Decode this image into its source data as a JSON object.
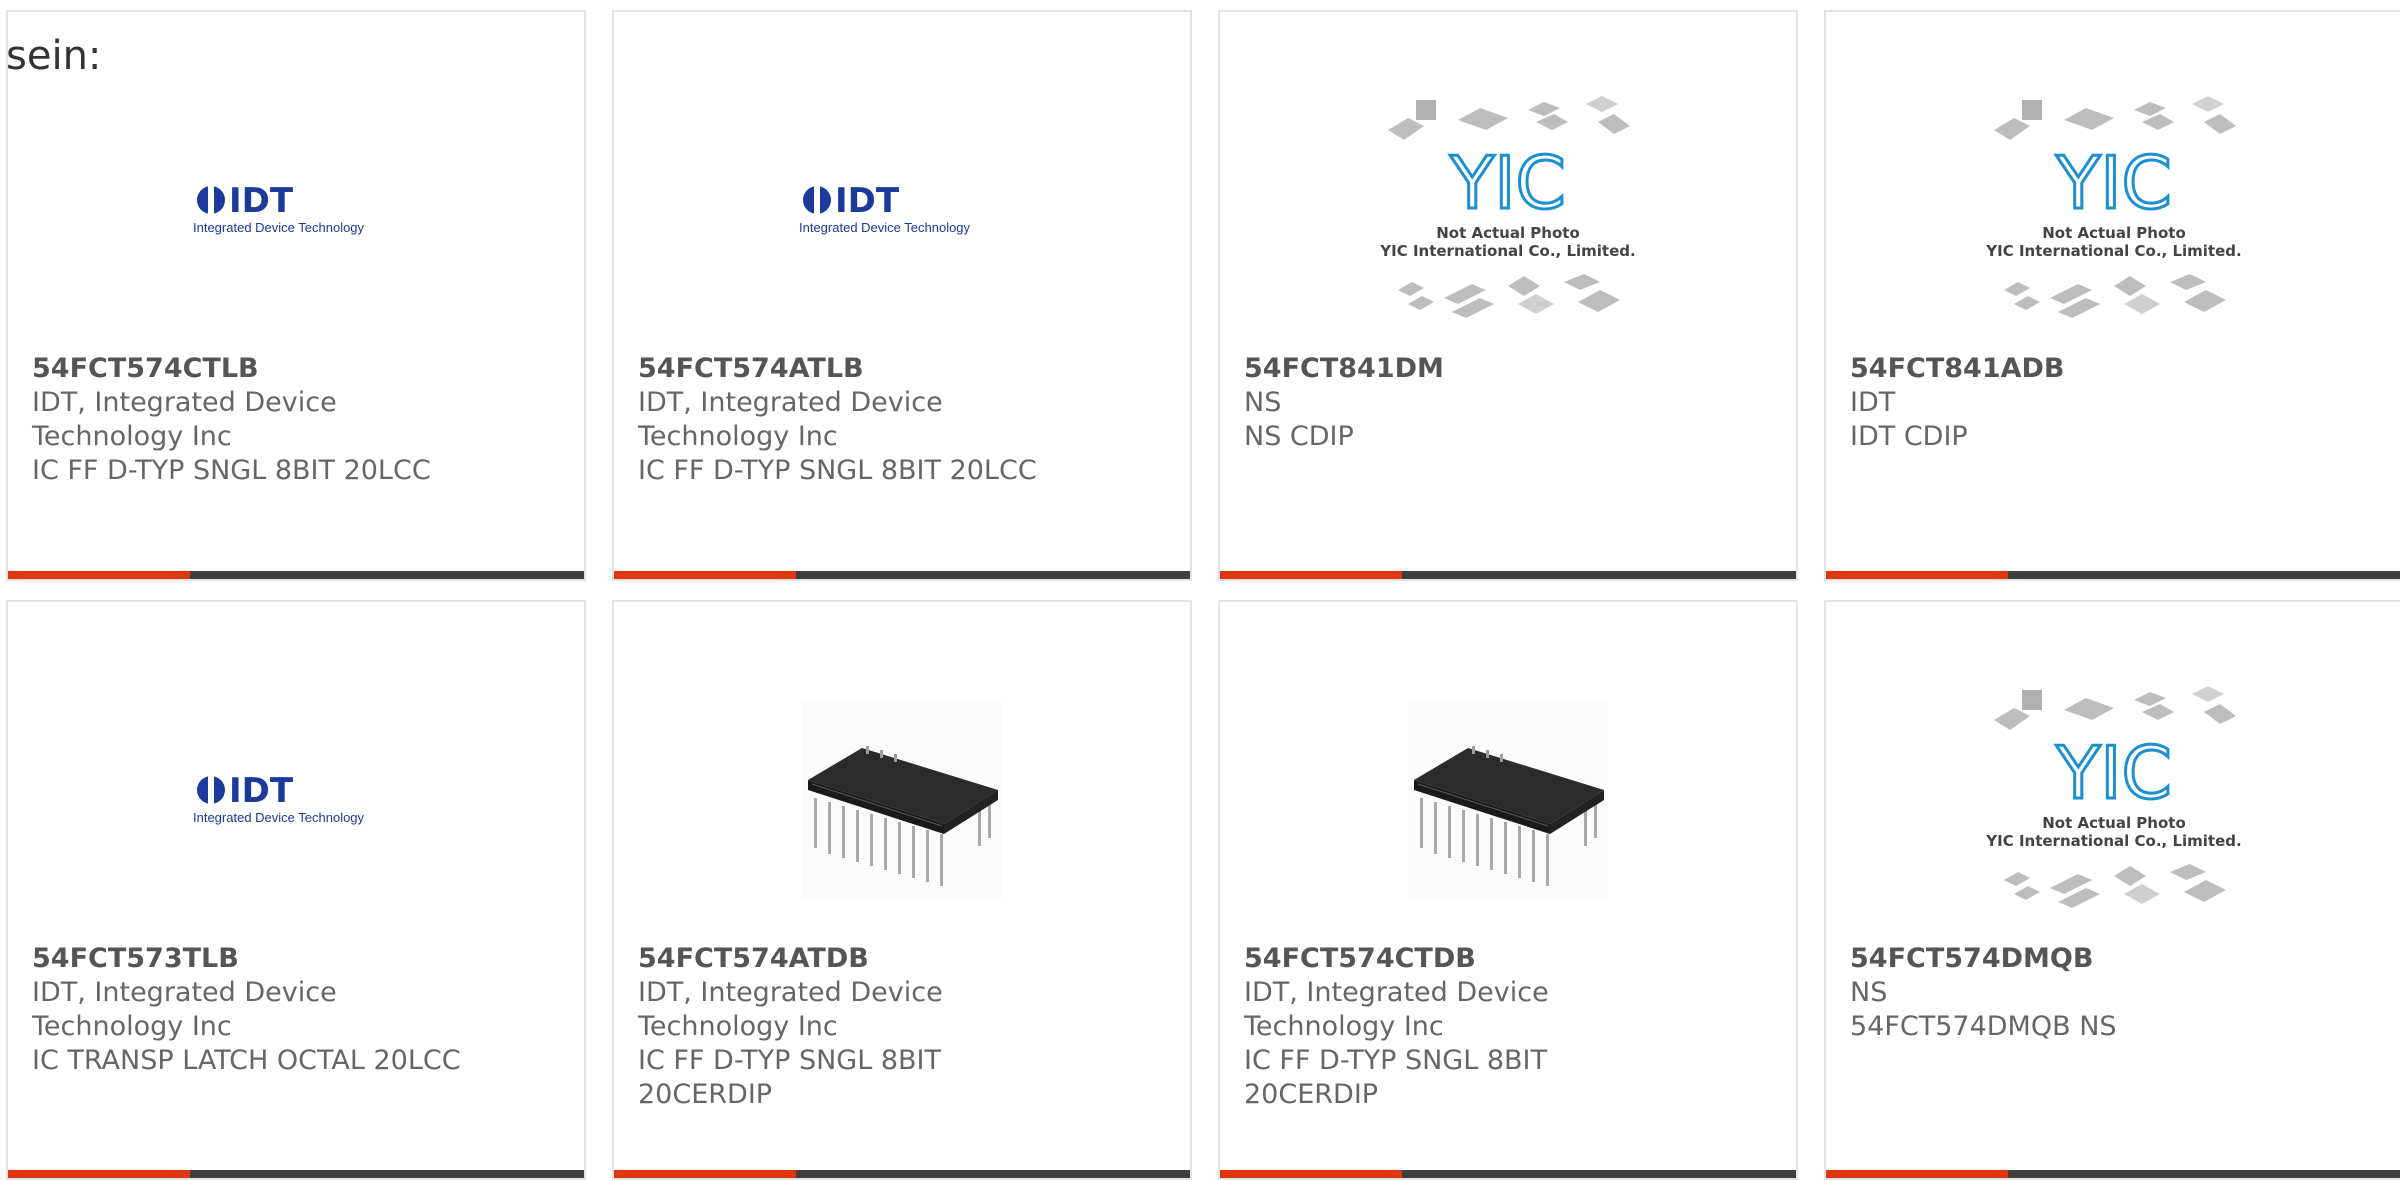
{
  "heading": "sein:",
  "colors": {
    "accent_bar": "#e0360f",
    "dark_bar": "#3f3f3f",
    "idt_blue": "#1b3a9a",
    "yic_blue": "#1b8fd0"
  },
  "idt_logo": {
    "mark": "IDT",
    "subtitle": "Integrated Device Technology"
  },
  "yic_placeholder": {
    "mark": "YIC",
    "line1": "Not Actual Photo",
    "line2": "YIC International Co., Limited."
  },
  "products": [
    {
      "image": "idt-logo",
      "part": "54FCT574CTLB",
      "lines": [
        "IDT, Integrated Device",
        "Technology Inc",
        "IC FF D-TYP SNGL 8BIT 20LCC"
      ]
    },
    {
      "image": "idt-logo",
      "part": "54FCT574ATLB",
      "lines": [
        "IDT, Integrated Device",
        "Technology Inc",
        "IC FF D-TYP SNGL 8BIT 20LCC"
      ]
    },
    {
      "image": "yic-placeholder",
      "part": "54FCT841DM",
      "lines": [
        "NS",
        "NS CDIP"
      ]
    },
    {
      "image": "yic-placeholder",
      "part": "54FCT841ADB",
      "lines": [
        "IDT",
        "IDT CDIP"
      ]
    },
    {
      "image": "idt-logo",
      "part": "54FCT573TLB",
      "lines": [
        "IDT, Integrated Device",
        "Technology Inc",
        "IC TRANSP LATCH OCTAL 20LCC"
      ]
    },
    {
      "image": "dip-chip-photo",
      "part": "54FCT574ATDB",
      "lines": [
        "IDT, Integrated Device",
        "Technology Inc",
        "IC FF D-TYP SNGL 8BIT",
        "20CERDIP"
      ]
    },
    {
      "image": "dip-chip-photo",
      "part": "54FCT574CTDB",
      "lines": [
        "IDT, Integrated Device",
        "Technology Inc",
        "IC FF D-TYP SNGL 8BIT",
        "20CERDIP"
      ]
    },
    {
      "image": "yic-placeholder",
      "part": "54FCT574DMQB",
      "lines": [
        "NS",
        "54FCT574DMQB NS"
      ]
    }
  ]
}
